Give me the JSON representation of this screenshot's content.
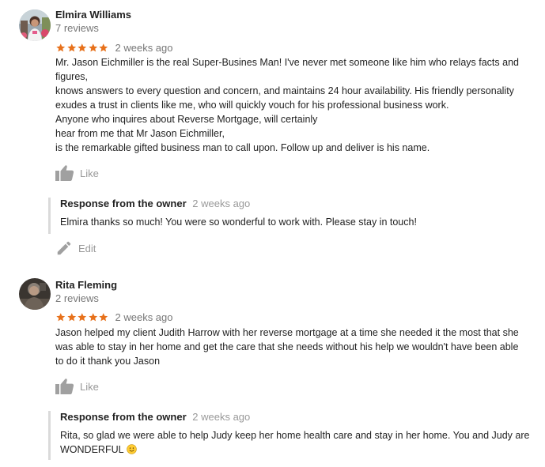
{
  "reviews": [
    {
      "author": "Elmira Williams",
      "review_count": "7 reviews",
      "rating": 5,
      "date": "2 weeks ago",
      "text": "Mr. Jason Eichmiller is the real Super-Busines Man!  I've never met someone like him who relays facts and figures,\nknows answers to every question and concern, and maintains 24 hour availability.   His friendly personality exudes a trust in clients like me, who will quickly vouch for his professional business work.\nAnyone who inquires about Reverse Mortgage, will certainly\nhear from me that Mr Jason Eichmiller,\nis the remarkable gifted business man to call upon.  Follow up and deliver is his name.",
      "like_label": "Like",
      "response": {
        "title": "Response from the owner",
        "date": "2 weeks ago",
        "text": "Elmira thanks so much! You were so wonderful to work with. Please stay in touch!",
        "edit_label": "Edit"
      }
    },
    {
      "author": "Rita Fleming",
      "review_count": "2 reviews",
      "rating": 5,
      "date": "2 weeks ago",
      "text": "Jason helped my client Judith Harrow with her reverse mortgage at a time she needed it the most that she was able to stay in her home and get the care that she needs without his help we wouldn't have been able to do it thank you Jason",
      "like_label": "Like",
      "response": {
        "title": "Response from the owner",
        "date": "2 weeks ago",
        "text": "Rita, so glad we were able to help Judy keep her home health care and stay in her home. You and Judy are WONDERFUL",
        "emoji": "smiling-face-emoji"
      }
    }
  ],
  "colors": {
    "star": "#e7711b",
    "muted_text": "#777777",
    "icon_gray": "#a0a0a0",
    "response_bar": "#dadada"
  }
}
